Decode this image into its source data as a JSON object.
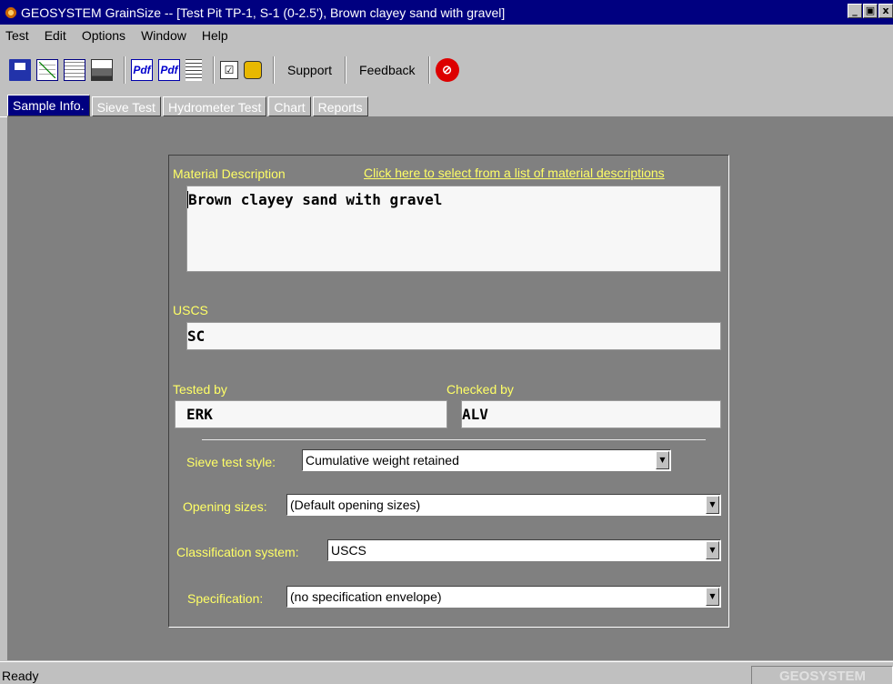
{
  "window": {
    "title": "GEOSYSTEM GrainSize -- [Test Pit TP-1, S-1 (0-2.5'), Brown clayey sand with gravel]",
    "minimize": "_",
    "restore": "̸",
    "close": "x"
  },
  "menu": {
    "test": "Test",
    "edit": "Edit",
    "options": "Options",
    "window": "Window",
    "help": "Help"
  },
  "toolbar": {
    "pdf1": "Pdf",
    "pdf2": "Pdf",
    "check": "☑",
    "support": "Support",
    "feedback": "Feedback",
    "stop": "⊘"
  },
  "tabs": {
    "sample_info": "Sample Info.",
    "sieve_test": "Sieve Test",
    "hydrometer_test": "Hydrometer Test",
    "chart": "Chart",
    "reports": "Reports"
  },
  "form": {
    "material_description_label": "Material Description",
    "material_description_link": "Click here to select from a list of material descriptions",
    "material_description": "Brown clayey sand with gravel",
    "uscs_label": "USCS",
    "uscs": "SC",
    "tested_by_label": "Tested by",
    "tested_by": "ERK",
    "checked_by_label": "Checked by",
    "checked_by": "ALV",
    "sieve_test_style_label": "Sieve test style:",
    "sieve_test_style": "Cumulative weight retained",
    "opening_sizes_label": "Opening sizes:",
    "opening_sizes": "(Default opening sizes)",
    "classification_system_label": "Classification system:",
    "classification_system": "USCS",
    "specification_label": "Specification:",
    "specification": "(no specification envelope)"
  },
  "status": {
    "text": "Ready",
    "brand": "GEOSYSTEM"
  }
}
